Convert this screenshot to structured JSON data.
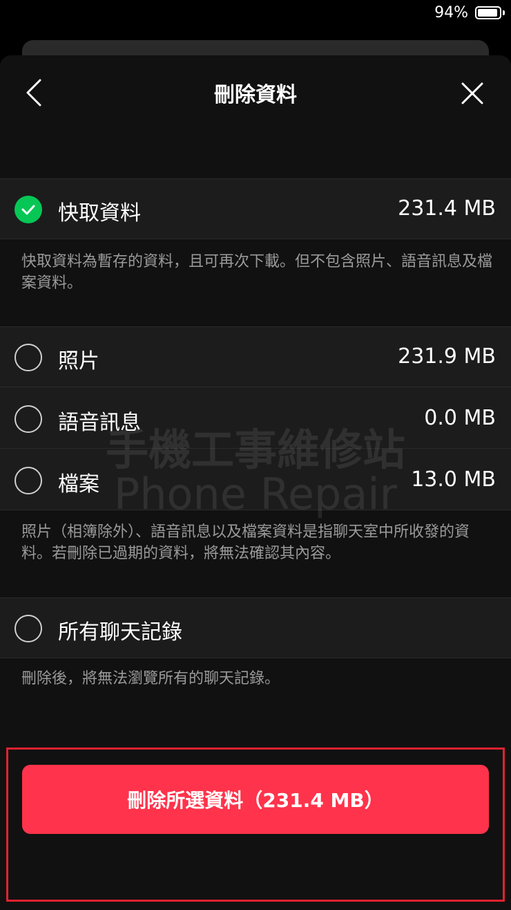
{
  "status_bar": {
    "battery_percent": "94%",
    "battery_level": 0.94
  },
  "header": {
    "title": "刪除資料"
  },
  "items": [
    {
      "label": "快取資料",
      "size": "231.4 MB",
      "selected": true
    },
    {
      "label": "照片",
      "size": "231.9 MB",
      "selected": false
    },
    {
      "label": "語音訊息",
      "size": "0.0 MB",
      "selected": false
    },
    {
      "label": "檔案",
      "size": "13.0 MB",
      "selected": false
    },
    {
      "label": "所有聊天記錄",
      "selected": false
    }
  ],
  "descriptions": {
    "cache": "快取資料為暫存的資料，且可再次下載。但不包含照片、語音訊息及檔案資料。",
    "media": "照片（相簿除外）、語音訊息以及檔案資料是指聊天室中所收發的資料。若刪除已過期的資料，將無法確認其內容。",
    "history": "刪除後，將無法瀏覽所有的聊天記錄。"
  },
  "watermark": {
    "line1": "手機工事維修站",
    "line2": "Phone Repair"
  },
  "delete_button": {
    "label": "刪除所選資料（231.4 MB）"
  },
  "colors": {
    "background": "#000000",
    "sheet": "#111111",
    "row": "#1c1c1c",
    "accent_green": "#06c755",
    "delete_red": "#ff334b",
    "highlight_red": "#e02230"
  }
}
